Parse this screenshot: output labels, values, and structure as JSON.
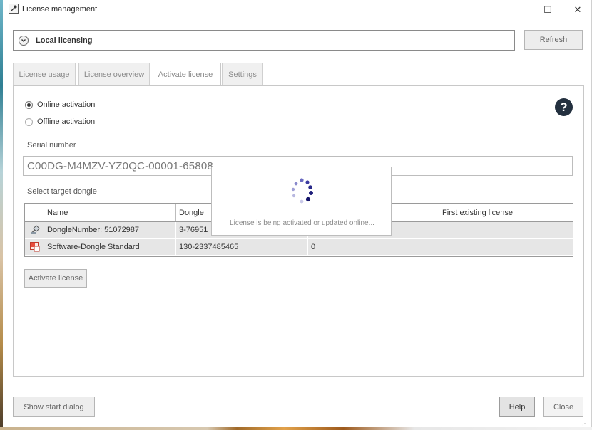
{
  "window": {
    "title": "License management",
    "controls": {
      "minimize": "—",
      "maximize": "☐",
      "close": "✕"
    }
  },
  "local_licensing": {
    "label": "Local licensing",
    "refresh_label": "Refresh"
  },
  "tabs": [
    {
      "label": "License usage"
    },
    {
      "label": "License overview"
    },
    {
      "label": "Activate license"
    },
    {
      "label": "Settings"
    }
  ],
  "activation": {
    "online_label": "Online activation",
    "offline_label": "Offline activation",
    "selected": "Online activation",
    "help_label": "?"
  },
  "serial": {
    "label": "Serial number",
    "value": "C00DG-M4MZV-YZ0QC-00001-65808"
  },
  "dongle_table": {
    "label": "Select target dongle",
    "columns": [
      "Name",
      "Dongle",
      "",
      "First existing license"
    ],
    "rows": [
      {
        "icon": "usb-dongle-icon",
        "name": "DongleNumber: 51072987",
        "dongle": "3-76951",
        "col3": "",
        "first_license": ""
      },
      {
        "icon": "software-dongle-icon",
        "name": "Software-Dongle Standard",
        "dongle": "130-2337485465",
        "col3": "0",
        "first_license": ""
      }
    ]
  },
  "activate_button": "Activate license",
  "progress": {
    "message": "License is being activated or updated online..."
  },
  "footer": {
    "show_start_dialog": "Show start dialog",
    "help": "Help",
    "close": "Close"
  },
  "colors": {
    "accent": "#23303f",
    "spinner": "#2a2a8a"
  }
}
